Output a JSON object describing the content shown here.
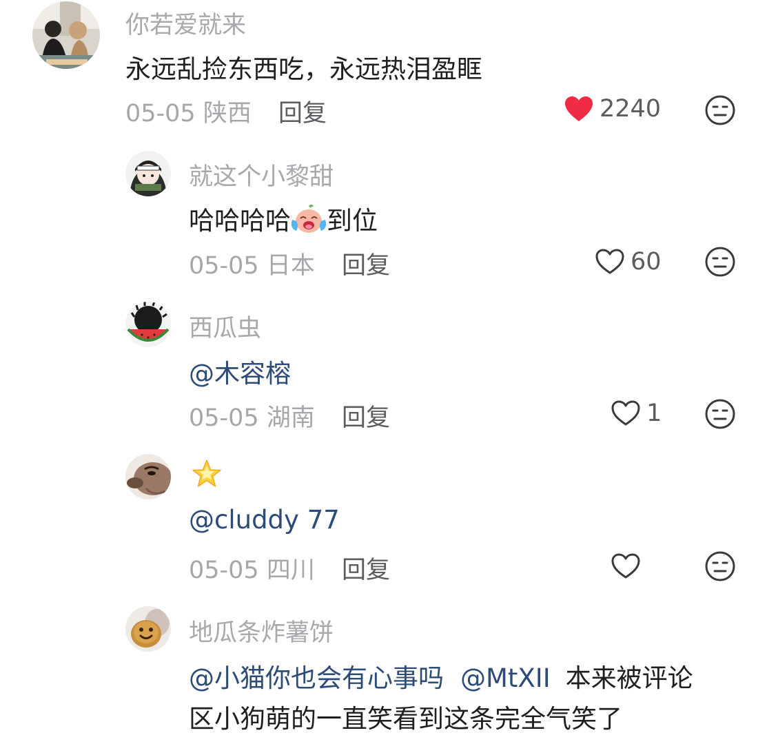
{
  "comments": [
    {
      "username": "你若爱就来",
      "text": "永远乱捡东西吃，永远热泪盈眶",
      "date": "05-05",
      "location": "陕西",
      "reply_label": "回复",
      "likes": "2240",
      "liked": true
    },
    {
      "username": "就这个小黎甜",
      "text_before_emoji": "哈哈哈哈",
      "emoji": "crying-laughing-face-emoji",
      "text_after_emoji": "到位",
      "date": "05-05",
      "location": "日本",
      "reply_label": "回复",
      "likes": "60",
      "liked": false
    },
    {
      "username": "西瓜虫",
      "mention": "@木容榕",
      "date": "05-05",
      "location": "湖南",
      "reply_label": "回复",
      "likes": "1",
      "liked": false
    },
    {
      "username_emoji": "glowing-star-emoji",
      "mention": "@cluddy 77",
      "date": "05-05",
      "location": "四川",
      "reply_label": "回复",
      "likes": "",
      "liked": false
    },
    {
      "username": "地瓜条炸薯饼",
      "mention1": "@小猫你也会有心事吗",
      "mention2": "@MtXII",
      "text_line1": "本来被评论",
      "text_line2": "区小狗萌的一直笑看到这条完全气笑了"
    }
  ],
  "colors": {
    "username": "#a9a9ad",
    "text": "#1f1f22",
    "mention": "#2c4b78",
    "meta": "#a7a7ab",
    "reply": "#5b5b60",
    "heart_active": "#f02b46"
  }
}
